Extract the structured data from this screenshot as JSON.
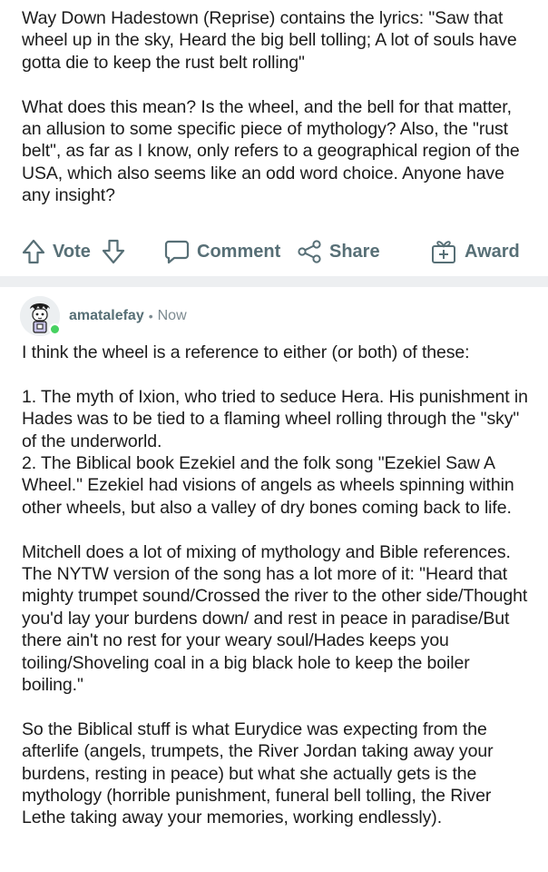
{
  "post": {
    "paragraphs": [
      "Way Down Hadestown (Reprise) contains the lyrics: \"Saw that wheel up in the sky, Heard the big bell tolling; A lot of souls have gotta die to keep the rust belt rolling\"",
      "What does this mean? Is the wheel, and the bell for that matter, an allusion to some specific piece of mythology? Also, the \"rust belt\", as far as I know, only refers to a geographical region of the USA, which also seems like an odd word choice. Anyone have any insight?"
    ]
  },
  "actions": {
    "vote_label": "Vote",
    "comment_label": "Comment",
    "share_label": "Share",
    "award_label": "Award",
    "icons": [
      "upvote-icon",
      "downvote-icon",
      "comment-icon",
      "share-icon",
      "award-icon"
    ],
    "color": "#576f76"
  },
  "comment": {
    "username": "amatalefay",
    "separator": "•",
    "time": "Now",
    "online_color": "#46d160",
    "intro": "I think the wheel is a reference to either (or both) of these:",
    "list": [
      "1. The myth of Ixion, who tried to seduce Hera. His punishment in Hades was to be tied to a flaming wheel rolling through the \"sky\" of the underworld.",
      "2. The Biblical book Ezekiel and the folk song \"Ezekiel Saw A Wheel.\" Ezekiel had visions of angels as wheels spinning within other wheels, but also a valley of dry bones coming back to life."
    ],
    "paragraph_2": "Mitchell does a lot of mixing of mythology and Bible references. The NYTW version of the song has a lot more of it: \"Heard that mighty trumpet sound/Crossed the river to the other side/Thought you'd lay your burdens down/ and rest in peace in paradise/But there ain't no rest for your weary soul/Hades keeps you toiling/Shoveling coal in a big black hole to keep the boiler boiling.\"",
    "paragraph_3": "So the Biblical stuff is what Eurydice was expecting from the afterlife (angels, trumpets, the River Jordan taking away your burdens, resting in peace) but what she actually gets is the mythology (horrible punishment, funeral bell tolling, the River Lethe taking away your memories, working endlessly)."
  }
}
